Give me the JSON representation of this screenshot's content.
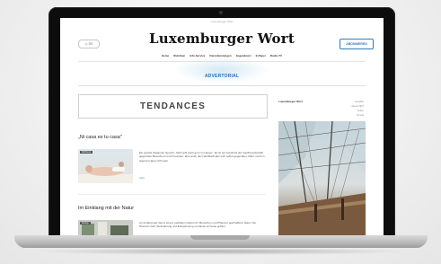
{
  "site": {
    "logo": "Luxemburger Wort",
    "subscribe_button": "ABONNIEREN",
    "lang_selector": "DE",
    "top_strip": "Luxemburger Wort",
    "nav": [
      "Home",
      "Rubriken",
      "Info-Service",
      "Dienstleistungen",
      "Jugendwort",
      "E-Paper",
      "Radio-TV"
    ]
  },
  "section_label": "ADVERTORIAL",
  "hero_title": "TENDANCES",
  "articles": [
    {
      "title": "„Ni casa es tu casa\"",
      "tag": "Wellness",
      "text": "Ein jeweils bekannter Spruch: „Mich gibt auch gern zu Hause\". Es ist ein Ausdruck der Gastfreundschaft gegenüber Besuchern und Freunden, aber auch dem Wohlbefinden sich selbst gegenüber. Mehr noch im eigenen Haus nicht sein.",
      "more": "mehr"
    },
    {
      "title": "Im Einklang mit der Natur",
      "tag": "Design",
      "text": "Am Anfang war das in einem perfekten Garten für Menschen und Pflanzen geschaffene Haus. Der Wunsch nach Veränderung und Entspannung zu Hause ist heute größer."
    }
  ],
  "sidebar": {
    "title": "Luxemburger Wort",
    "meta": [
      "Ausgabe",
      "Januar 2017",
      "Seiten",
      "Format"
    ]
  },
  "colors": {
    "accent": "#2b7cc4",
    "advertorial": "#2b6ea8",
    "laptop_bezel": "#0d0d0d"
  }
}
